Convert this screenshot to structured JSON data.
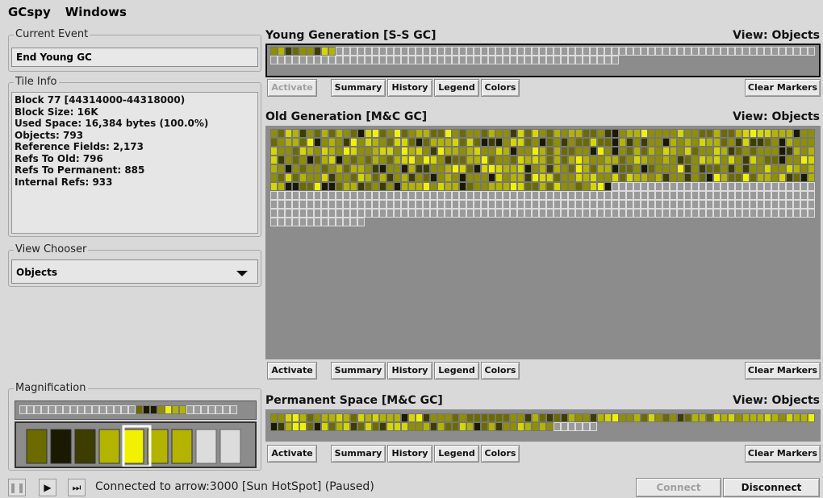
{
  "menu": [
    "GCspy",
    "Windows"
  ],
  "current_event": {
    "title": "Current Event",
    "value": "End Young GC"
  },
  "tile_info": {
    "title": "Tile Info",
    "lines": [
      "Block 77  [44314000-44318000)",
      "Block Size: 16K",
      "Used Space: 16,384 bytes  (100.0%)",
      "Objects: 793",
      "Reference Fields: 2,173",
      "Refs To Old: 796",
      "Refs To Permanent: 885",
      "Internal Refs: 933"
    ]
  },
  "view_chooser": {
    "title": "View Chooser",
    "selected": "Objects"
  },
  "magnification": {
    "title": "Magnification"
  },
  "panels": [
    {
      "id": "young",
      "title": "Young Generation  [S-S GC]",
      "view": "View: Objects",
      "filled_cells": 9,
      "total_cells": 123
    },
    {
      "id": "old",
      "title": "Old Generation  [M&C GC]",
      "view": "View: Objects",
      "filled_cells": 497,
      "total_cells": 763
    },
    {
      "id": "perm",
      "title": "Permanent Space  [M&C GC]",
      "view": "View: Objects",
      "filled_cells": 114,
      "total_cells": 120
    }
  ],
  "buttons": {
    "activate": "Activate",
    "summary": "Summary",
    "history": "History",
    "legend": "Legend",
    "colors": "Colors",
    "clear_markers": "Clear Markers"
  },
  "status": {
    "text": "Connected to arrow:3000 [Sun HotSpot]  (Paused)",
    "connect": "Connect",
    "disconnect": "Disconnect",
    "pause_icon": "pause-icon",
    "play_icon": "play-icon",
    "step_icon": "step-icon"
  },
  "colors": {
    "empty": "#9a9a9a",
    "palette": [
      "#1a1a00",
      "#3d3d00",
      "#6b6b00",
      "#8f8f00",
      "#b3b300",
      "#d6d600",
      "#f2f200"
    ]
  }
}
